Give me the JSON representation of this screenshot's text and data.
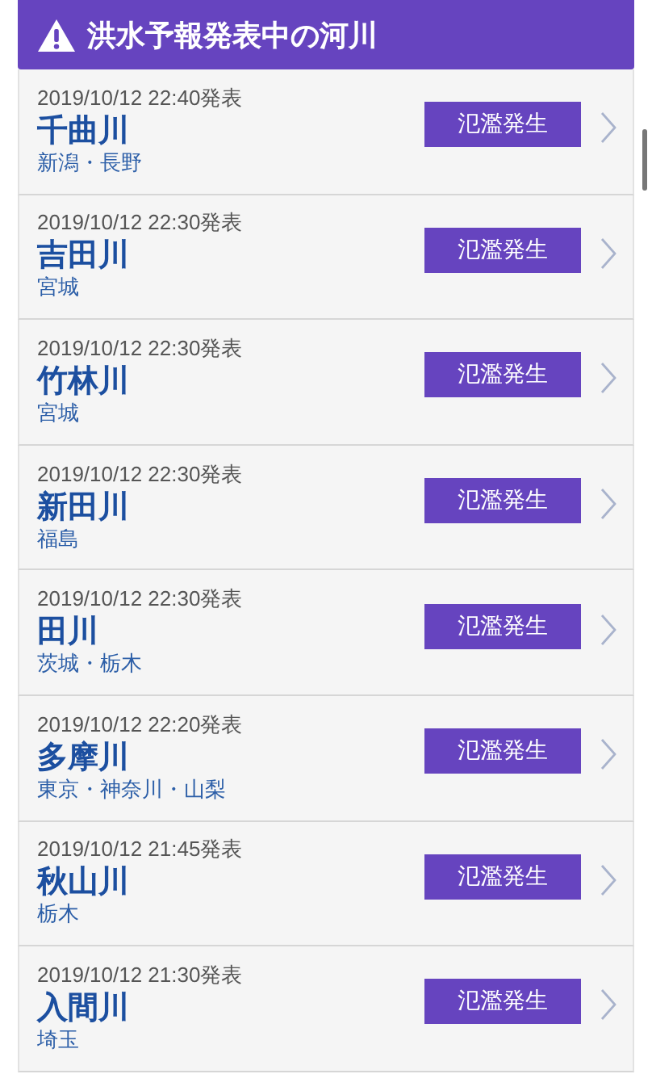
{
  "header": {
    "title": "洪水予報発表中の河川"
  },
  "rivers": [
    {
      "time": "2019/10/12 22:40発表",
      "name": "千曲川",
      "area": "新潟・長野",
      "status": "氾濫発生"
    },
    {
      "time": "2019/10/12 22:30発表",
      "name": "吉田川",
      "area": "宮城",
      "status": "氾濫発生"
    },
    {
      "time": "2019/10/12 22:30発表",
      "name": "竹林川",
      "area": "宮城",
      "status": "氾濫発生"
    },
    {
      "time": "2019/10/12 22:30発表",
      "name": "新田川",
      "area": "福島",
      "status": "氾濫発生"
    },
    {
      "time": "2019/10/12 22:30発表",
      "name": "田川",
      "area": "茨城・栃木",
      "status": "氾濫発生"
    },
    {
      "time": "2019/10/12 22:20発表",
      "name": "多摩川",
      "area": "東京・神奈川・山梨",
      "status": "氾濫発生"
    },
    {
      "time": "2019/10/12 21:45発表",
      "name": "秋山川",
      "area": "栃木",
      "status": "氾濫発生"
    },
    {
      "time": "2019/10/12 21:30発表",
      "name": "入間川",
      "area": "埼玉",
      "status": "氾濫発生"
    }
  ]
}
